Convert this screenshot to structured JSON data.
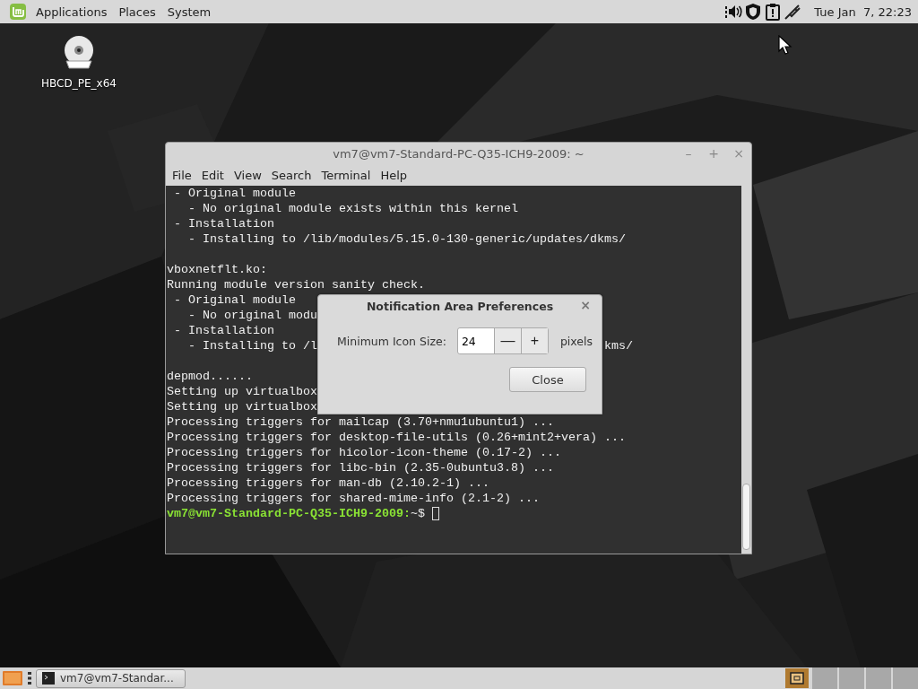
{
  "top_panel": {
    "menus": [
      {
        "label": "Applications"
      },
      {
        "label": "Places"
      },
      {
        "label": "System"
      }
    ],
    "clock": "Tue Jan  7, 22:23"
  },
  "desktop_icons": [
    {
      "label": "HBCD_PE_x64"
    }
  ],
  "terminal": {
    "title": "vm7@vm7-Standard-PC-Q35-ICH9-2009: ~",
    "controls": [
      "–",
      "+",
      "×"
    ],
    "menu": [
      "File",
      "Edit",
      "View",
      "Search",
      "Terminal",
      "Help"
    ],
    "lines": [
      {
        "kind": "text",
        "text": " - Original module"
      },
      {
        "kind": "text",
        "text": "   - No original module exists within this kernel"
      },
      {
        "kind": "text",
        "text": " - Installation"
      },
      {
        "kind": "text",
        "text": "   - Installing to /lib/modules/5.15.0-130-generic/updates/dkms/"
      },
      {
        "kind": "blank"
      },
      {
        "kind": "text",
        "text": "vboxnetflt.ko:"
      },
      {
        "kind": "text",
        "text": "Running module version sanity check."
      },
      {
        "kind": "text",
        "text": " - Original module"
      },
      {
        "kind": "text",
        "text": "   - No original modu"
      },
      {
        "kind": "text",
        "text": " - Installation"
      },
      {
        "kind": "text",
        "text": "   - Installing to /l",
        "tail": "kms/"
      },
      {
        "kind": "blank"
      },
      {
        "kind": "text",
        "text": "depmod......"
      },
      {
        "kind": "text",
        "text": "Setting up virtualbox"
      },
      {
        "kind": "text",
        "text": "Setting up virtualbox"
      },
      {
        "kind": "text",
        "text": "Processing triggers for mailcap (3.70+nmu1ubuntu1) ..."
      },
      {
        "kind": "text",
        "text": "Processing triggers for desktop-file-utils (0.26+mint2+vera) ..."
      },
      {
        "kind": "text",
        "text": "Processing triggers for hicolor-icon-theme (0.17-2) ..."
      },
      {
        "kind": "text",
        "text": "Processing triggers for libc-bin (2.35-0ubuntu3.8) ..."
      },
      {
        "kind": "text",
        "text": "Processing triggers for man-db (2.10.2-1) ..."
      },
      {
        "kind": "text",
        "text": "Processing triggers for shared-mime-info (2.1-2) ..."
      },
      {
        "kind": "prompt",
        "user_host": "vm7@vm7-Standard-PC-Q35-ICH9-2009:",
        "path": "~$"
      }
    ]
  },
  "dialog": {
    "title": "Notification Area Preferences",
    "close": "×",
    "label": "Minimum Icon Size:",
    "value": "24",
    "decrement": "—",
    "increment": "+",
    "unit": "pixels",
    "button": "Close"
  },
  "taskbar": {
    "tasks": [
      {
        "label": "vm7@vm7-Standar...",
        "selected": false
      }
    ]
  }
}
